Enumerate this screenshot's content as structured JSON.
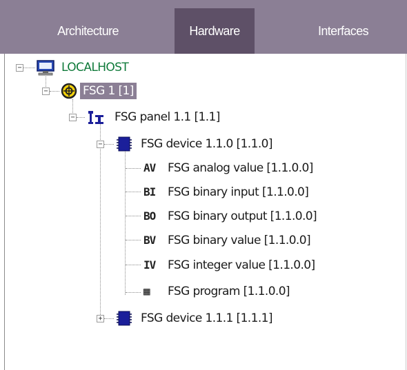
{
  "tabs": [
    {
      "label": "Architecture",
      "active": false
    },
    {
      "label": "Hardware",
      "active": true
    },
    {
      "label": "Interfaces",
      "active": false
    }
  ],
  "tree": {
    "root": {
      "label": "LOCALHOST",
      "icon": "computer-icon",
      "expanded": true
    },
    "fsg": {
      "label": "FSG 1 [1]",
      "icon": "fsg-gear-icon",
      "expanded": true,
      "selected": true
    },
    "panel": {
      "label": "FSG panel 1.1 [1.1]",
      "icon": "panel-icon",
      "expanded": true
    },
    "device0": {
      "label": "FSG device 1.1.0 [1.1.0]",
      "icon": "device-chip-icon",
      "expanded": true
    },
    "objects": [
      {
        "label": "FSG analog value [1.1.0.0]",
        "icon": "analog-value-icon",
        "glyph": "AV"
      },
      {
        "label": "FSG binary input [1.1.0.0]",
        "icon": "binary-input-icon",
        "glyph": "BI"
      },
      {
        "label": "FSG binary output [1.1.0.0]",
        "icon": "binary-output-icon",
        "glyph": "BO"
      },
      {
        "label": "FSG binary value [1.1.0.0]",
        "icon": "binary-value-icon",
        "glyph": "BV"
      },
      {
        "label": "FSG integer value [1.1.0.0]",
        "icon": "integer-value-icon",
        "glyph": "IV"
      },
      {
        "label": "FSG program [1.1.0.0]",
        "icon": "program-icon",
        "glyph": "▦"
      }
    ],
    "device1": {
      "label": "FSG device 1.1.1 [1.1.1]",
      "icon": "device-chip-icon",
      "expanded": false
    }
  },
  "expander": {
    "expanded_symbol": "−",
    "collapsed_symbol": "+"
  },
  "colors": {
    "tab_bar": "#8b7f95",
    "tab_active": "#5e5067",
    "selection": "#8b7f95",
    "root_text": "#0f7a3a",
    "chip": "#1b1f9a"
  }
}
